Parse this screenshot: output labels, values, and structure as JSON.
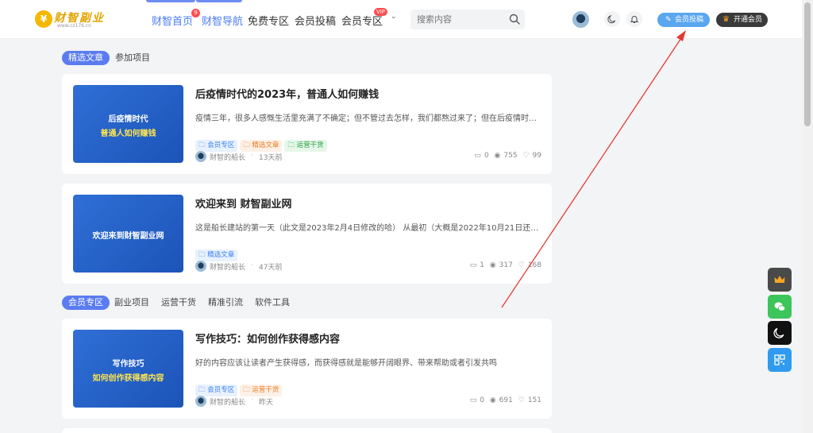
{
  "header": {
    "logo": {
      "text": "财智副业",
      "url": "www.cz176.cn",
      "mark": "¥"
    },
    "nav": [
      {
        "label": "财智首页",
        "badge": "9"
      },
      {
        "label": "财智导航"
      },
      {
        "label": "免费专区"
      },
      {
        "label": "会员投稿"
      },
      {
        "label": "会员专区",
        "badge": "VIP"
      }
    ],
    "search_placeholder": "搜索内容",
    "contribute_label": "会员投稿",
    "vip_label": "开通会员"
  },
  "sections": [
    {
      "tabs": [
        "精选文章",
        "参加项目"
      ],
      "cards": [
        {
          "thumb": [
            "后疫情时代",
            "普通人如何赚钱"
          ],
          "title": "后疫情时代的2023年，普通人如何赚钱",
          "excerpt": "疫情三年，很多人感慨生活里充满了不确定；但不管过去怎样，我们都熬过来了；但在后疫情时代，普通人如何赚钱…",
          "tags": [
            {
              "label": "会员专区",
              "color": "blue"
            },
            {
              "label": "精选文章",
              "color": "orange"
            },
            {
              "label": "运营干货",
              "color": "green"
            }
          ],
          "author": "财智的船长",
          "time": "13天前",
          "comments": "0",
          "views": "755",
          "likes": "99"
        },
        {
          "thumb": [
            "欢迎来到财智副业网"
          ],
          "title": "欢迎来到 财智副业网",
          "excerpt": "这是船长建站的第一天（此文是2023年2月4日修改的哈） 从最初（大概是2022年10月21日还…",
          "tags": [
            {
              "label": "精选文章",
              "color": "blue"
            }
          ],
          "author": "财智的船长",
          "time": "47天前",
          "comments": "1",
          "views": "317",
          "likes": "168"
        }
      ]
    },
    {
      "tabs": [
        "会员专区",
        "副业项目",
        "运营干货",
        "精准引流",
        "软件工具"
      ],
      "cards": [
        {
          "thumb": [
            "写作技巧",
            "如何创作获得感内容"
          ],
          "title": "写作技巧：如何创作获得感内容",
          "excerpt": "好的内容应该让读者产生获得感，而获得感就是能够开阔眼界、带来帮助或者引发共鸣",
          "tags": [
            {
              "label": "会员专区",
              "color": "blue"
            },
            {
              "label": "运营干货",
              "color": "orange"
            }
          ],
          "author": "财智的船长",
          "time": "昨天",
          "comments": "0",
          "views": "691",
          "likes": "151"
        }
      ]
    }
  ],
  "floating": [
    {
      "name": "crown-icon",
      "color": "#4a4a4a"
    },
    {
      "name": "wechat-icon",
      "color": "#3cc55a"
    },
    {
      "name": "moon-icon",
      "color": "#111111"
    },
    {
      "name": "qrcode-icon",
      "color": "#2f9af0"
    }
  ],
  "colors": {
    "accent": "#5b7cf0",
    "annotation": "#e53935"
  }
}
